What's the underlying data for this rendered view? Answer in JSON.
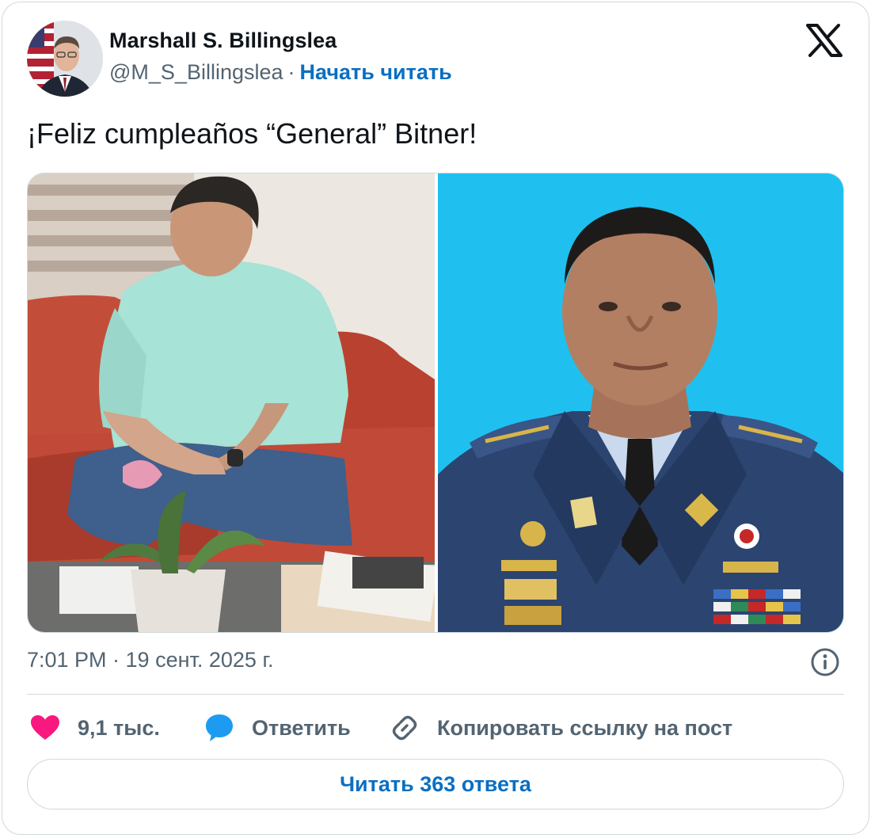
{
  "tweet": {
    "author": {
      "name": "Marshall S. Billingslea",
      "handle": "@M_S_Billingslea",
      "separator": "·",
      "follow_label": "Начать читать"
    },
    "text": "¡Feliz cumpleaños “General” Bitner!",
    "timestamp": "7:01 PM · 19 сент. 2025 г.",
    "actions": {
      "likes_count": "9,1 тыс.",
      "reply_label": "Ответить",
      "copy_link_label": "Копировать ссылку на пост"
    },
    "read_replies_label": "Читать 363 ответа"
  },
  "icons": {
    "brand": "x-logo-icon",
    "info": "info-icon",
    "like": "heart-icon",
    "reply": "speech-bubble-icon",
    "copy": "link-icon"
  },
  "colors": {
    "accent": "#0a6fc2",
    "heart": "#f91880",
    "reply_bubble": "#1d9bf0",
    "muted_text": "#536471",
    "border": "#cfd9de",
    "photo_background_right": "#1fc0ef"
  }
}
